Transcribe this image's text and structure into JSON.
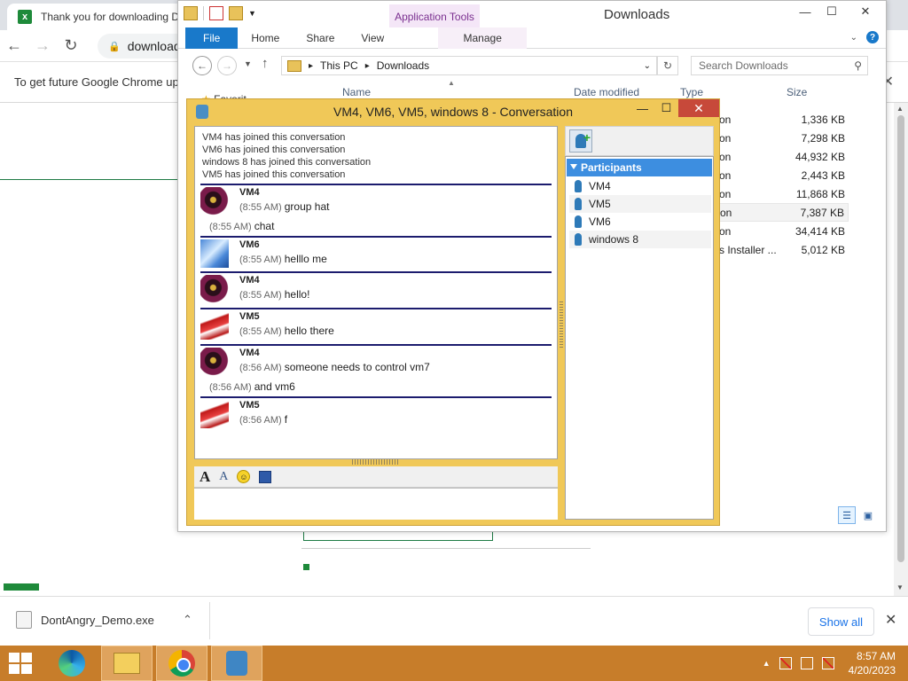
{
  "chrome": {
    "tab_title": "Thank you for downloading D",
    "tab_favicon": "x",
    "address_text": "download",
    "infobar_text": "To get future Google Chrome up",
    "downloads": {
      "file_name": "DontAngry_Demo.exe",
      "show_all_label": "Show all"
    }
  },
  "explorer": {
    "title": "Downloads",
    "contextual_tab_group": "Application Tools",
    "ribbon_tabs": [
      "File",
      "Home",
      "Share",
      "View",
      "Manage"
    ],
    "breadcrumb": [
      "This PC",
      "Downloads"
    ],
    "search_placeholder": "Search Downloads",
    "columns": {
      "name": "Name",
      "date": "Date modified",
      "type": "Type",
      "size": "Size"
    },
    "nav_partial": "Favorit",
    "files": [
      {
        "type": "on",
        "size": "1,336 KB"
      },
      {
        "type": "on",
        "size": "7,298 KB"
      },
      {
        "type": "on",
        "size": "44,932 KB"
      },
      {
        "type": "on",
        "size": "2,443 KB"
      },
      {
        "type": "on",
        "size": "11,868 KB"
      },
      {
        "type": "on",
        "size": "7,387 KB"
      },
      {
        "type": "on",
        "size": "34,414 KB"
      },
      {
        "type": "s Installer ...",
        "size": "5,012 KB"
      }
    ]
  },
  "conversation": {
    "title": "VM4, VM6, VM5, windows 8 - Conversation",
    "system_messages": [
      "VM4 has joined this conversation",
      "VM6 has joined this conversation",
      "windows 8 has joined this conversation",
      "VM5 has joined this conversation"
    ],
    "messages": [
      {
        "sender": "VM4",
        "lines": [
          {
            "time": "(8:55 AM)",
            "text": "group hat"
          },
          {
            "time": "(8:55 AM)",
            "text": "chat"
          }
        ]
      },
      {
        "sender": "VM6",
        "lines": [
          {
            "time": "(8:55 AM)",
            "text": "helllo me"
          }
        ]
      },
      {
        "sender": "VM4",
        "lines": [
          {
            "time": "(8:55 AM)",
            "text": "hello!"
          }
        ]
      },
      {
        "sender": "VM5",
        "lines": [
          {
            "time": "(8:55 AM)",
            "text": "hello there"
          }
        ]
      },
      {
        "sender": "VM4",
        "lines": [
          {
            "time": "(8:56 AM)",
            "text": "someone needs to control vm7"
          },
          {
            "time": "(8:56 AM)",
            "text": "and vm6"
          }
        ]
      },
      {
        "sender": "VM5",
        "lines": [
          {
            "time": "(8:56 AM)",
            "text": "f"
          }
        ]
      }
    ],
    "participants_header": "Participants",
    "participants": [
      "VM4",
      "VM5",
      "VM6",
      "windows 8"
    ]
  },
  "taskbar": {
    "time": "8:57 AM",
    "date": "4/20/2023"
  },
  "colors": {
    "conversation_frame": "#f0c858",
    "taskbar": "#c77d2a",
    "file_tab": "#1979ca",
    "participants_header": "#3d8ee0",
    "message_divider": "#1c1c6e"
  }
}
